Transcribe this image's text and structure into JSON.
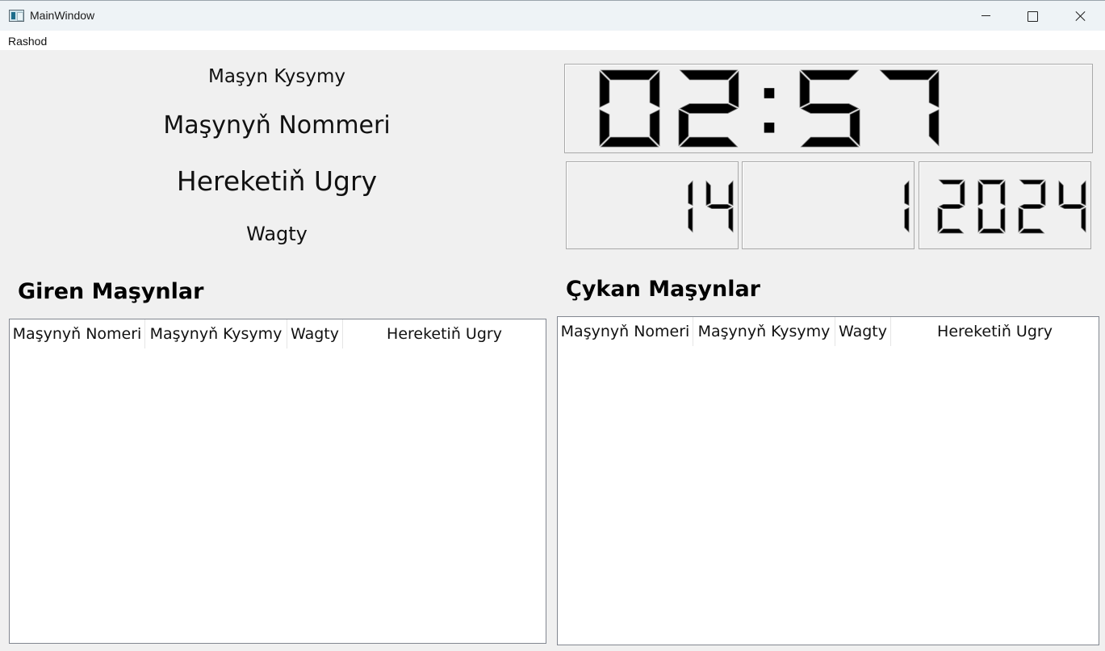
{
  "window": {
    "title": "MainWindow",
    "icon": "app-window-icon",
    "controls": [
      "minimize",
      "maximize",
      "close"
    ]
  },
  "menu": {
    "items": [
      {
        "label": "Rashod"
      }
    ]
  },
  "info": {
    "car_type": "Maşyn Kysymy",
    "car_number": "Maşynyň Nommeri",
    "direction": "Hereketiň Ugry",
    "time": "Wagty"
  },
  "clock": {
    "time": "02:57",
    "day": "14",
    "month": "1",
    "year": "2024"
  },
  "incoming": {
    "title": "Giren Maşynlar",
    "columns": [
      "Maşynyň Nomeri",
      "Maşynyň Kysymy",
      "Wagty",
      "Hereketiň Ugry"
    ],
    "rows": []
  },
  "outgoing": {
    "title": "Çykan Maşynlar",
    "columns": [
      "Maşynyň Nomeri",
      "Maşynyň Kysymy",
      "Wagty",
      "Hereketiň Ugry"
    ],
    "rows": []
  }
}
